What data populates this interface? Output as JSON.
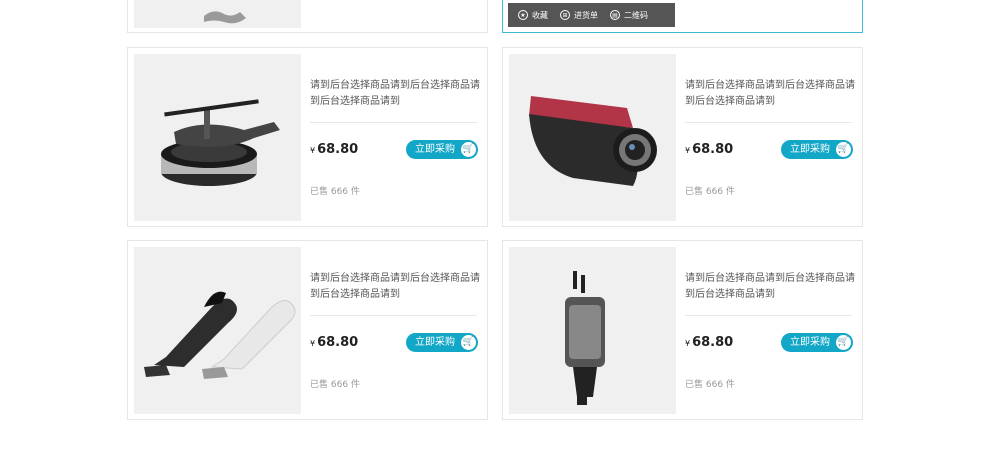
{
  "top_toolbar": {
    "items": [
      {
        "label": "收藏",
        "icon": "star-icon"
      },
      {
        "label": "进货单",
        "icon": "cart-icon"
      },
      {
        "label": "二维码",
        "icon": "qrcode-icon"
      }
    ]
  },
  "products": [
    {
      "title": "请到后台选择商品请到后台选择商品请到后台选择商品请到",
      "currency": "¥",
      "price": "68.80",
      "buy_label": "立即采购",
      "sold": "已售 666 件",
      "image": "car-air-freshener-helicopter"
    },
    {
      "title": "请到后台选择商品请到后台选择商品请到后台选择商品请到",
      "currency": "¥",
      "price": "68.80",
      "buy_label": "立即采购",
      "sold": "已售 666 件",
      "image": "dash-camera"
    },
    {
      "title": "请到后台选择商品请到后台选择商品请到后台选择商品请到",
      "currency": "¥",
      "price": "68.80",
      "buy_label": "立即采购",
      "sold": "已售 666 件",
      "image": "handheld-vacuums"
    },
    {
      "title": "请到后台选择商品请到后台选择商品请到后台选择商品请到",
      "currency": "¥",
      "price": "68.80",
      "buy_label": "立即采购",
      "sold": "已售 666 件",
      "image": "car-charger"
    }
  ],
  "colors": {
    "accent": "#12a6c7",
    "active_border": "#3fb9cf",
    "image_bg": "#f0f0f0"
  }
}
